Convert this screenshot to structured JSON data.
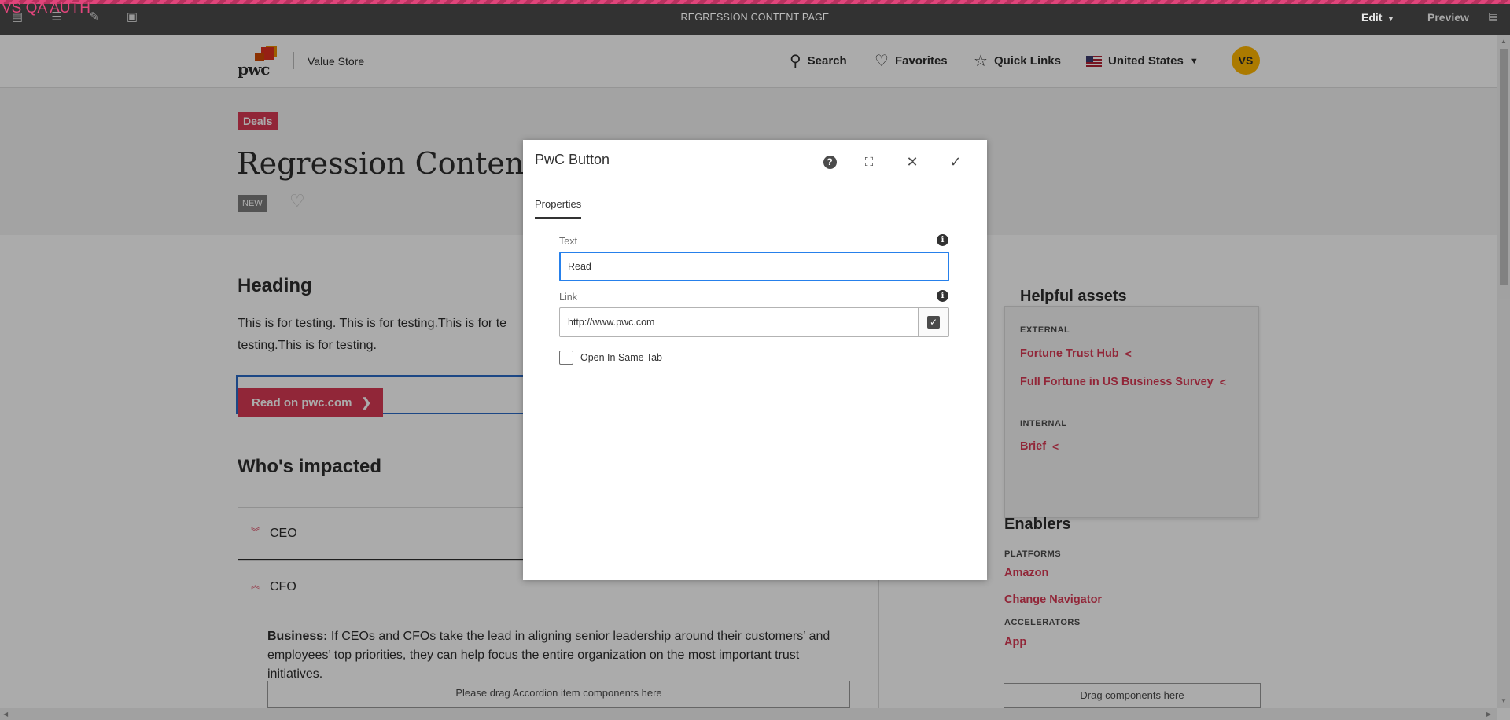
{
  "editor": {
    "env_label": "VS QA AUTH",
    "page_title": "REGRESSION CONTENT PAGE",
    "mode_label": "Edit",
    "preview_label": "Preview",
    "tools": [
      "panel-toggle-icon",
      "properties-icon",
      "brush-icon",
      "annotation-icon"
    ]
  },
  "header": {
    "logo_text": "pwc",
    "brand": "Value Store",
    "nav": {
      "search": "Search",
      "favorites": "Favorites",
      "quick_links": "Quick Links",
      "country": "United States"
    },
    "avatar_initials": "VS"
  },
  "hero": {
    "tag": "Deals",
    "title": "Regression Content",
    "badge": "NEW"
  },
  "main": {
    "heading": "Heading",
    "body": "This is for testing. This is for testing.This is for te testing.This is for testing.",
    "cta_label": "Read on pwc.com",
    "impacted_heading": "Who's impacted",
    "accordion": [
      {
        "label": "CEO"
      },
      {
        "label": "CFO"
      }
    ],
    "accordion_body_bold": "Business:",
    "accordion_body": " If CEOs and CFOs take the lead in aligning senior leadership around their customers’ and employees’ top priorities, they can help focus the entire organization on the most important trust initiatives.",
    "drop_zone_text": "Please drag Accordion item components here"
  },
  "sidebar": {
    "helpful_title": "Helpful assets",
    "external_label": "EXTERNAL",
    "external_links": [
      "Fortune Trust Hub",
      "Full Fortune in US Business Survey"
    ],
    "internal_label": "INTERNAL",
    "internal_links": [
      "Brief"
    ],
    "enablers_title": "Enablers",
    "platforms_label": "PLATFORMS",
    "platforms": [
      "Amazon",
      "Change Navigator"
    ],
    "accelerators_label": "ACCELERATORS",
    "accelerators": [
      "App"
    ],
    "drop_zone_text": "Drag components here"
  },
  "dialog": {
    "title": "PwC Button",
    "tab": "Properties",
    "text_label": "Text",
    "text_value": "Read",
    "link_label": "Link",
    "link_value": "http://www.pwc.com",
    "checkbox_label": "Open In Same Tab",
    "checkbox_checked": false
  },
  "colors": {
    "accent": "#d93954",
    "focus": "#2680eb",
    "toolbar": "#323232",
    "avatar": "#ffb600"
  }
}
